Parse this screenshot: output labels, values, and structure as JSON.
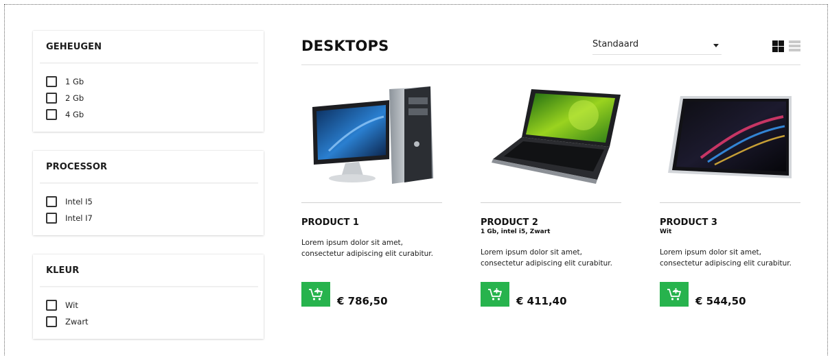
{
  "filters": [
    {
      "title": "GEHEUGEN",
      "options": [
        "1 Gb",
        "2 Gb",
        "4 Gb"
      ]
    },
    {
      "title": "PROCESSOR",
      "options": [
        "Intel I5",
        "Intel I7"
      ]
    },
    {
      "title": "KLEUR",
      "options": [
        "Wit",
        "Zwart"
      ]
    }
  ],
  "main": {
    "title": "DESKTOPS",
    "sort_selected": "Standaard",
    "view_mode": "grid"
  },
  "products": [
    {
      "name": "PRODUCT 1",
      "subtitle": "",
      "description": "Lorem ipsum dolor sit amet, consectetur adipiscing elit curabitur.",
      "price": "€ 786,50",
      "image": "desktop-computer"
    },
    {
      "name": "PRODUCT 2",
      "subtitle": "1 Gb, intel i5, Zwart",
      "description": "Lorem ipsum dolor sit amet, consectetur adipiscing elit curabitur.",
      "price": "€ 411,40",
      "image": "laptop"
    },
    {
      "name": "PRODUCT 3",
      "subtitle": "Wit",
      "description": "Lorem ipsum dolor sit amet, consectetur adipiscing elit curabitur.",
      "price": "€ 544,50",
      "image": "tablet"
    }
  ],
  "colors": {
    "accent": "#27b34d",
    "text": "#111111",
    "divider": "#dcdcdc"
  },
  "icons": {
    "cart": "add-to-cart-icon",
    "grid": "grid-view-icon",
    "list": "list-view-icon",
    "sort": "chevron-down-icon"
  }
}
